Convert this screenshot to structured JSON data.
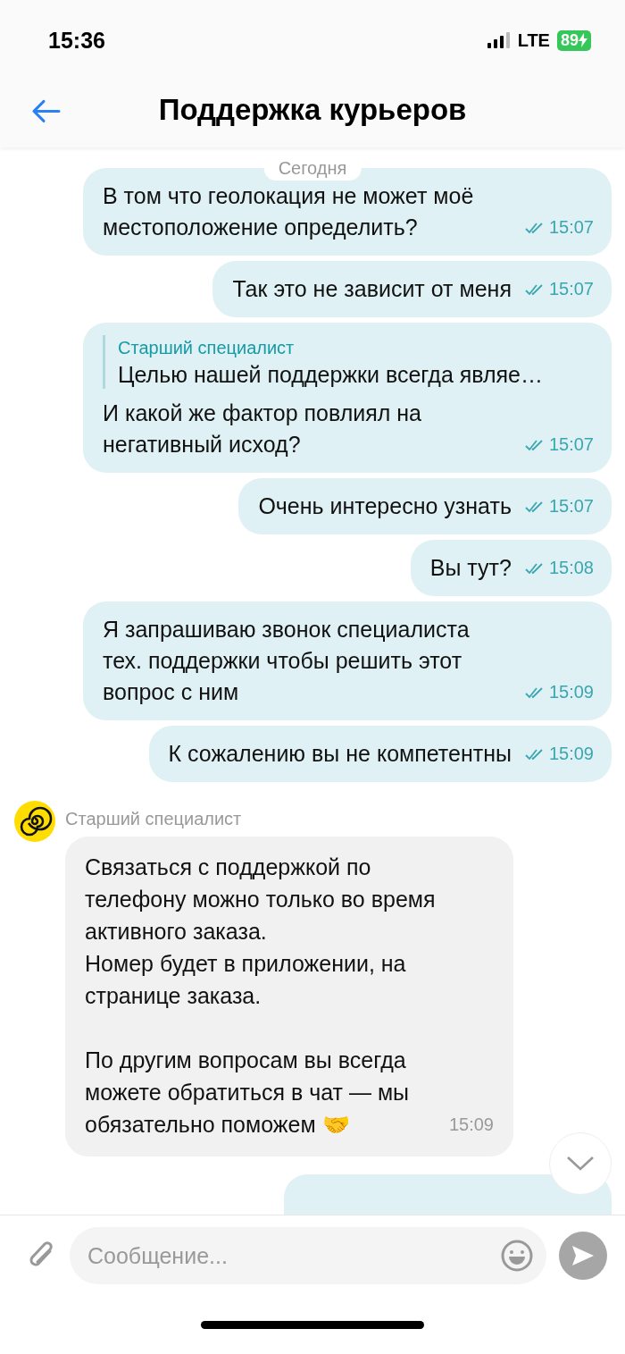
{
  "status_bar": {
    "time": "15:36",
    "network": "LTE",
    "battery": "89"
  },
  "header": {
    "title": "Поддержка курьеров"
  },
  "date_label": "Сегодня",
  "messages": [
    {
      "kind": "outgoing",
      "text": "В том что геолокация не может моё местоположение определить?",
      "time": "15:07",
      "read": true
    },
    {
      "kind": "outgoing",
      "text": "Так это не зависит от меня",
      "time": "15:07",
      "read": true
    },
    {
      "kind": "outgoing",
      "quote": {
        "author": "Старший специалист",
        "text": "Целью нашей поддержки всегда являе…"
      },
      "text": "И какой же фактор повлиял на негативный исход?",
      "time": "15:07",
      "read": true
    },
    {
      "kind": "outgoing",
      "text": "Очень интересно узнать",
      "time": "15:07",
      "read": true
    },
    {
      "kind": "outgoing",
      "text": "Вы тут?",
      "time": "15:08",
      "read": true
    },
    {
      "kind": "outgoing",
      "text": "Я запрашиваю звонок специалиста тех. поддержки чтобы решить этот вопрос с ним",
      "time": "15:09",
      "read": true
    },
    {
      "kind": "outgoing",
      "text": "К сожалению вы не компетентны",
      "time": "15:09",
      "read": true
    },
    {
      "kind": "incoming",
      "author": "Старший специалист",
      "text": "Связаться с поддержкой по телефону можно только во время активного заказа.\nНомер будет в приложении, на странице заказа.\n\nПо другим вопросам вы всегда можете обратиться в чат — мы обязательно поможем 🤝",
      "time": "15:09"
    },
    {
      "kind": "cut"
    }
  ],
  "composer": {
    "placeholder": "Сообщение..."
  }
}
